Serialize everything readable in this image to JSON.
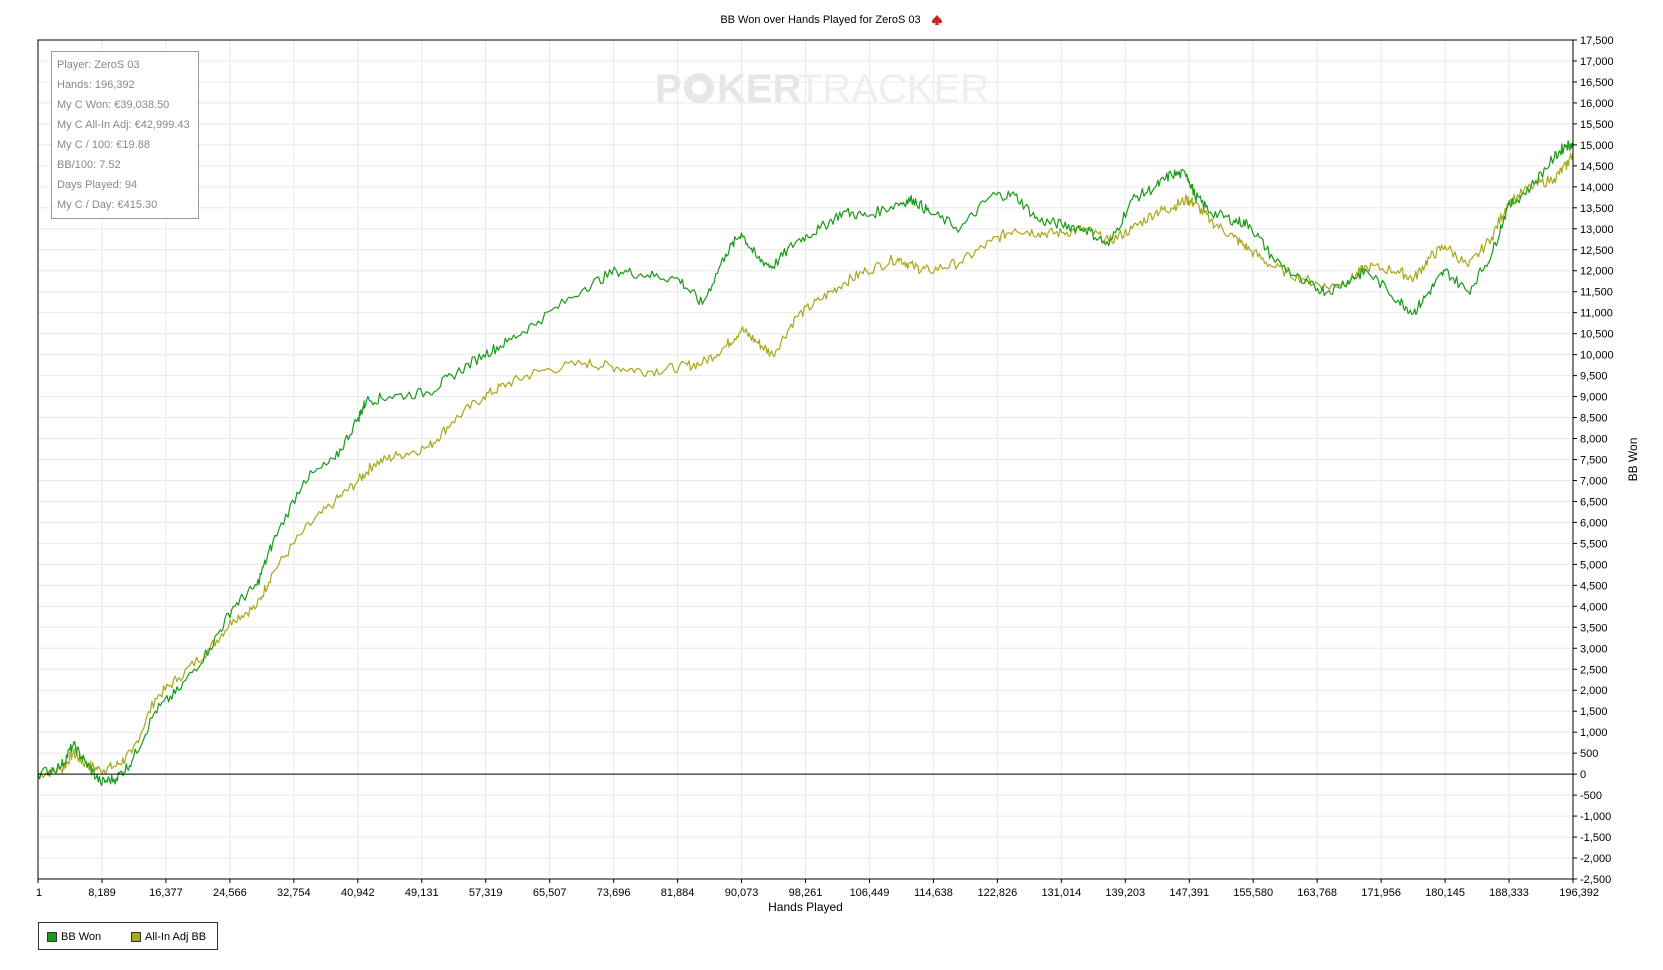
{
  "header": {
    "title": "BB Won over Hands Played for ZeroS 03",
    "icon": "spade-icon"
  },
  "watermark": {
    "part1": "P",
    "part2": "KER",
    "part3": "TRACKER"
  },
  "stats": [
    "Player: ZeroS 03",
    "Hands: 196,392",
    "My C Won: €39,038.50",
    "My C All-In Adj: €42,999.43",
    "My C / 100: €19.88",
    "BB/100: 7.52",
    "Days Played: 94",
    "My C / Day: €415.30"
  ],
  "legend": [
    {
      "label": "BB Won",
      "color": "#1a9a1a"
    },
    {
      "label": "All-In Adj BB",
      "color": "#a8a81a"
    }
  ],
  "colors": {
    "bb_won": "#1a9a1a",
    "allin_adj": "#a8a81a",
    "grid": "#e8e8e8",
    "accent": "#cc2222"
  },
  "chart_data": {
    "type": "line",
    "title": "BB Won over Hands Played for ZeroS 03",
    "xlabel": "Hands Played",
    "ylabel": "BB Won",
    "xlim": [
      1,
      196392
    ],
    "ylim": [
      -2500,
      17500
    ],
    "x_ticks": [
      "1",
      "8,189",
      "16,377",
      "24,566",
      "32,754",
      "40,942",
      "49,131",
      "57,319",
      "65,507",
      "73,696",
      "81,884",
      "90,073",
      "98,261",
      "106,449",
      "114,638",
      "122,826",
      "131,014",
      "139,203",
      "147,391",
      "155,580",
      "163,768",
      "171,956",
      "180,145",
      "188,333",
      "196,392"
    ],
    "y_ticks": [
      "17,500",
      "17,000",
      "16,500",
      "16,000",
      "15,500",
      "15,000",
      "14,500",
      "14,000",
      "13,500",
      "13,000",
      "12,500",
      "12,000",
      "11,500",
      "11,000",
      "10,500",
      "10,000",
      "9,500",
      "9,000",
      "8,500",
      "8,000",
      "7,500",
      "7,000",
      "6,500",
      "6,000",
      "5,500",
      "5,000",
      "4,500",
      "4,000",
      "3,500",
      "3,000",
      "2,500",
      "2,000",
      "1,500",
      "1,000",
      "500",
      "0",
      "-500",
      "-1,000",
      "-1,500",
      "-2,000",
      "-2,500"
    ],
    "y_axis_side": "right",
    "grid": true,
    "legend_position": "bottom-left",
    "series": [
      {
        "name": "BB Won",
        "x": [
          1,
          3000,
          4500,
          6000,
          8000,
          10000,
          12000,
          15000,
          18000,
          22000,
          25000,
          28000,
          30000,
          34000,
          38000,
          41000,
          42000,
          45000,
          50000,
          53000,
          57000,
          60000,
          64000,
          70000,
          74000,
          78000,
          82000,
          85000,
          88000,
          90000,
          92000,
          94000,
          97000,
          100000,
          103000,
          106000,
          110000,
          112000,
          114000,
          118000,
          122000,
          125000,
          128000,
          131000,
          134000,
          137000,
          140000,
          143000,
          145000,
          147000,
          148000,
          150000,
          153000,
          155000,
          158000,
          162000,
          165000,
          168000,
          170000,
          174000,
          176000,
          178000,
          180000,
          183000,
          186000,
          188000,
          191000,
          194000,
          195500,
          196392
        ],
        "y": [
          0,
          200,
          700,
          300,
          -200,
          -100,
          300,
          1500,
          2000,
          3000,
          4000,
          4500,
          5500,
          7000,
          7500,
          8500,
          8900,
          9000,
          9100,
          9500,
          10000,
          10300,
          10800,
          11600,
          12000,
          11900,
          11800,
          11200,
          12400,
          12900,
          12300,
          12100,
          12700,
          13000,
          13400,
          13300,
          13600,
          13700,
          13400,
          13000,
          13800,
          13800,
          13200,
          13100,
          13000,
          12600,
          13700,
          14000,
          14300,
          14300,
          13800,
          13400,
          13200,
          13100,
          12300,
          11700,
          11500,
          11800,
          12000,
          11300,
          11000,
          11500,
          12000,
          11500,
          12400,
          13500,
          14000,
          14700,
          15000,
          15000
        ]
      },
      {
        "name": "All-In Adj BB",
        "x": [
          1,
          3000,
          4500,
          6000,
          8000,
          10000,
          12000,
          15000,
          18000,
          22000,
          25000,
          28000,
          30000,
          34000,
          38000,
          41000,
          43000,
          46000,
          50000,
          53000,
          57000,
          60000,
          64000,
          70000,
          74000,
          78000,
          82000,
          85000,
          88000,
          90000,
          92000,
          94000,
          97000,
          100000,
          103000,
          106000,
          110000,
          112000,
          114000,
          118000,
          122000,
          125000,
          128000,
          131000,
          134000,
          137000,
          140000,
          143000,
          145000,
          147000,
          148000,
          150000,
          153000,
          155000,
          158000,
          162000,
          165000,
          168000,
          170000,
          174000,
          176000,
          178000,
          180000,
          183000,
          186000,
          188000,
          191000,
          194000,
          195500,
          196392
        ],
        "y": [
          0,
          100,
          500,
          250,
          100,
          200,
          500,
          1800,
          2300,
          3000,
          3700,
          4000,
          4800,
          5800,
          6500,
          7000,
          7400,
          7600,
          7800,
          8400,
          9000,
          9300,
          9600,
          9800,
          9700,
          9600,
          9700,
          9800,
          10200,
          10600,
          10300,
          10000,
          10900,
          11300,
          11700,
          12000,
          12300,
          12100,
          12000,
          12200,
          12700,
          13000,
          12900,
          12900,
          13000,
          12700,
          13000,
          13400,
          13500,
          13700,
          13600,
          13200,
          12800,
          12500,
          12100,
          11800,
          11600,
          11800,
          12100,
          12000,
          11800,
          12300,
          12600,
          12100,
          12800,
          13600,
          14000,
          14200,
          14500,
          14800
        ]
      }
    ]
  }
}
